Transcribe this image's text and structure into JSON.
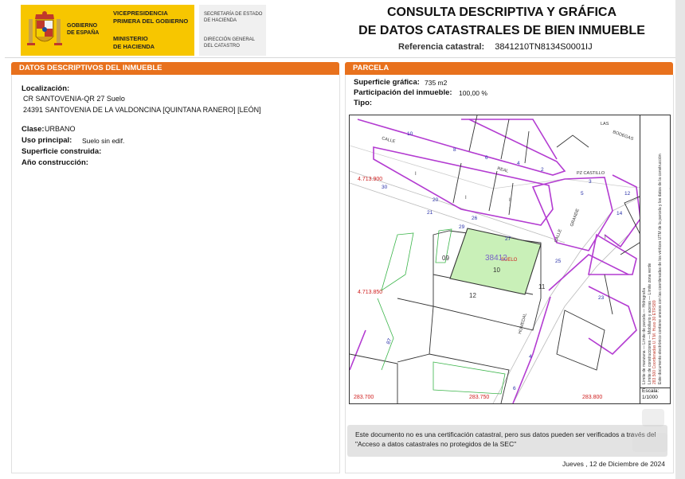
{
  "header": {
    "gob_line1": "GOBIERNO",
    "gob_line2": "DE ESPAÑA",
    "vice_line1": "VICEPRESIDENCIA",
    "vice_line2": "PRIMERA DEL GOBIERNO",
    "min_line1": "MINISTERIO",
    "min_line2": "DE HACIENDA",
    "sec_line1": "SECRETARÍA DE ESTADO",
    "sec_line2": "DE HACIENDA",
    "dir_line1": "DIRECCIÓN GENERAL",
    "dir_line2": "DEL CATASTRO",
    "title_line1": "CONSULTA DESCRIPTIVA Y GRÁFICA",
    "title_line2": "DE DATOS CATASTRALES DE BIEN INMUEBLE",
    "ref_label": "Referencia catastral:",
    "ref_value": "3841210TN8134S0001IJ"
  },
  "left": {
    "bar_title": "DATOS DESCRIPTIVOS DEL INMUEBLE",
    "localizacion_label": "Localización:",
    "loc_line1": "CR SANTOVENIA-QR 27 Suelo",
    "loc_line2": "24391 SANTOVENIA DE LA VALDONCINA [QUINTANA RANERO] [LEÓN]",
    "clase_label": "Clase:",
    "clase_value": "URBANO",
    "uso_label": "Uso principal:",
    "uso_value": "Suelo sin edif.",
    "superficie_label": "Superficie construida:",
    "anio_label": "Año construcción:"
  },
  "right": {
    "bar_title": "PARCELA",
    "sup_label": "Superficie gráfica:",
    "sup_value": "735 m2",
    "part_label": "Participación del inmueble:",
    "part_value": "100,00 %",
    "tipo_label": "Tipo:"
  },
  "map": {
    "coord_y1": "4.713.900",
    "coord_y2": "4.713.850",
    "coord_x1": "283.700",
    "coord_x2": "283.750",
    "coord_x3": "283.800",
    "parcel_code": "38412",
    "parcel_suelo": "SUELO",
    "street_calle": "CALLE",
    "street_real": "REAL",
    "street_pz": "PZ CASTILLO",
    "street_calle2": "CALLE",
    "street_grande": "GRANDE",
    "street_las": "LAS",
    "street_bodegas": "BODEGAS",
    "street_humedal": "HUMEDAL",
    "num_09": "09",
    "num_10": "10",
    "num_11": "11",
    "num_12": "12",
    "num_27": "27",
    "num_29": "29",
    "num_26": "26",
    "num_21": "21",
    "num_20": "20",
    "num_30": "30",
    "num_10b": "10",
    "num_8": "8",
    "num_6": "6",
    "num_4": "4",
    "num_2": "2",
    "num_25": "25",
    "num_23": "23",
    "num_14": "14",
    "num_12b": "12",
    "num_4b": "4",
    "num_6b": "6",
    "num_3": "3",
    "num_87": "87",
    "num_5": "5",
    "num_I1": "I",
    "num_I2": "I",
    "num_I3": "I",
    "num_I4": "I",
    "num_I5": "I"
  },
  "legend": {
    "l1": "Límite de manzana",
    "l2": "Límite de parcela",
    "l3": "Límite de construcciones",
    "l4": "Mobiliario y aceras",
    "l5": "Límite zona verde",
    "l6": "Hidrografía",
    "red1": "283.500 Coordenadas U.T.M. Huso 30 ETRS89",
    "red2": "Este documento electrónico contiene anexos con las coordenadas de los vértices UTM de la parcela y los datos de la construcción",
    "escala_label": "Escala:",
    "escala_value": "1/1000"
  },
  "notice": {
    "text": "Este documento no es una certificación catastral, pero sus datos pueden ser verificados a través del \"Acceso a datos catastrales no protegidos de la SEC\""
  },
  "date": "Jueves , 12 de Diciembre de 2024",
  "colors": {
    "orange": "#e8711d",
    "yellow": "#f7c600",
    "parcel_green": "#c9f0b8",
    "manzana_purple": "#b33bd1"
  }
}
